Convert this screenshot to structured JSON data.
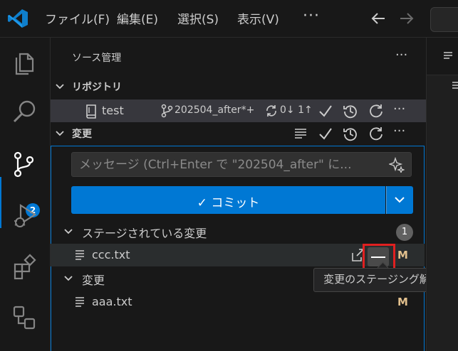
{
  "menu": {
    "file": "ファイル(F)",
    "edit": "編集(E)",
    "selection": "選択(S)",
    "view": "表示(V)",
    "more": "···"
  },
  "icons": {
    "app": "vscode-logo-icon",
    "explorer": "files-icon",
    "search": "search-icon",
    "scm": "source-control-icon",
    "debug": "run-debug-icon",
    "extensions": "extensions-icon",
    "remote": "remote-explorer-icon"
  },
  "activity": {
    "scm_badge": "2"
  },
  "panel": {
    "title": "ソース管理",
    "more": "···"
  },
  "repositories": {
    "header": "リポジトリ",
    "repo_name": "test",
    "branch": "202504_after*+",
    "sync": "0↓ 1↑"
  },
  "changes": {
    "header": "変更",
    "message_placeholder": "メッセージ (Ctrl+Enter で \"202504_after\" に...",
    "commit_label": "✓ コミット",
    "staged": {
      "label": "ステージされている変更",
      "count": "1",
      "files": [
        {
          "name": "ccc.txt",
          "status": "M"
        }
      ]
    },
    "unstaged": {
      "label": "変更",
      "files": [
        {
          "name": "aaa.txt",
          "status": "M"
        }
      ]
    },
    "tooltip": "変更のステージング解除"
  },
  "colors": {
    "accent": "#0078d4",
    "modified": "#e2c08d",
    "highlight": "#e02020"
  }
}
